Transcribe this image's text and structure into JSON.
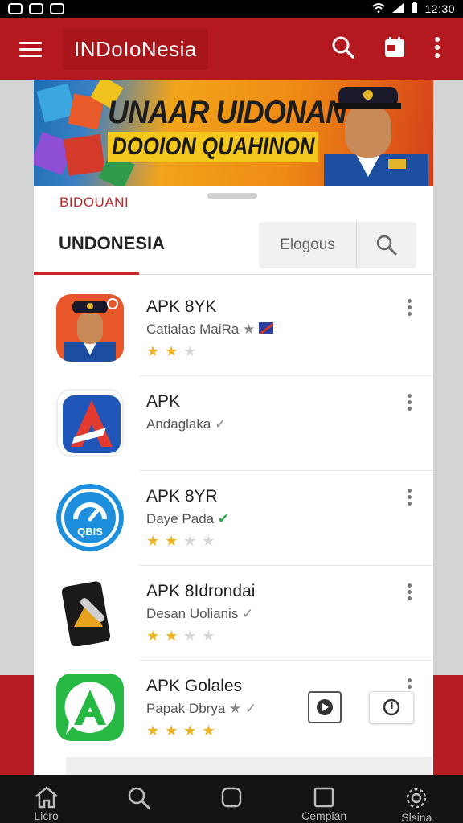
{
  "app": {
    "title": "INDoIoNesia"
  },
  "banner": {
    "line1": "UNAAR UIDONAN",
    "line2": "DOOION QUAHINON"
  },
  "sheet": {
    "section_label": "BIDOUANI",
    "tab_label": "UNDONESIA",
    "search": {
      "placeholder": "Elogous"
    }
  },
  "apps": [
    {
      "name": "APK 8YK",
      "subtitle": "Catialas MaiRa",
      "rating": 2,
      "max": 3,
      "icon": "officer-portrait-icon"
    },
    {
      "name": "APK",
      "subtitle": "Andaglaka",
      "icon": "red-a-logo-icon"
    },
    {
      "name": "APK 8YR",
      "subtitle": "Daye Pada",
      "rating": 2,
      "max": 4,
      "icon": "blue-gauge-icon",
      "icon_text": "QBIS"
    },
    {
      "name": "APK 8Idrondai",
      "subtitle": "Desan Uolianis",
      "rating": 2,
      "max": 4,
      "icon": "phone-wrench-icon"
    },
    {
      "name": "APK Golales",
      "subtitle": "Papak Dbrya",
      "rating": 4,
      "max": 4,
      "icon": "green-a-logo-icon"
    }
  ],
  "bottom_nav": [
    {
      "label": "Licro",
      "icon": "home-icon"
    },
    {
      "label": "",
      "icon": "search-icon"
    },
    {
      "label": "",
      "icon": "square-icon"
    },
    {
      "label": "Cempian",
      "icon": "window-icon"
    },
    {
      "label": "Slsina",
      "icon": "settings-icon"
    }
  ],
  "colors": {
    "primary": "#b3191f",
    "accent_underline": "#c8242a",
    "star": "#f0b323"
  }
}
